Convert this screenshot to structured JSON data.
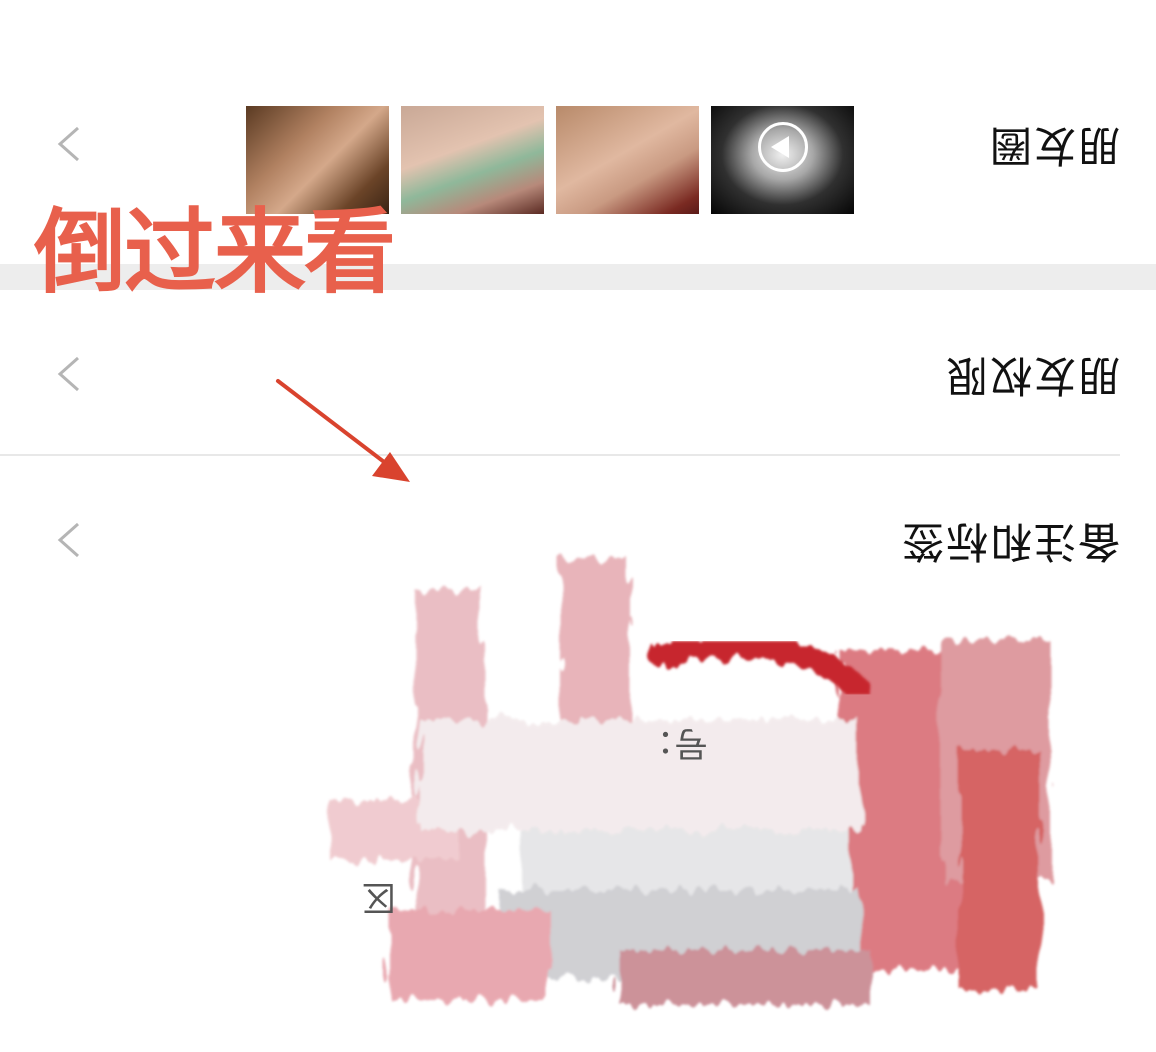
{
  "overlay": {
    "caption": "倒过来看",
    "caption_color": "#e8604c",
    "arrow_color": "#d9432e"
  },
  "rows": [
    {
      "label": "朋友圈",
      "icon": "chevron-icon",
      "has_thumbnails": true
    },
    {
      "label": "朋友权限",
      "icon": "chevron-icon"
    },
    {
      "label": "备注和标签",
      "icon": "chevron-icon"
    }
  ],
  "thumbnails": [
    {
      "type": "photo",
      "subject": "hand-bracelet"
    },
    {
      "type": "photo",
      "subject": "wrist-bracelet"
    },
    {
      "type": "photo",
      "subject": "wrist-bracelet"
    },
    {
      "type": "video",
      "subject": "silver-ring",
      "icon": "play-icon"
    }
  ],
  "redacted": {
    "visible_fragments": [
      "号：",
      "区"
    ]
  }
}
